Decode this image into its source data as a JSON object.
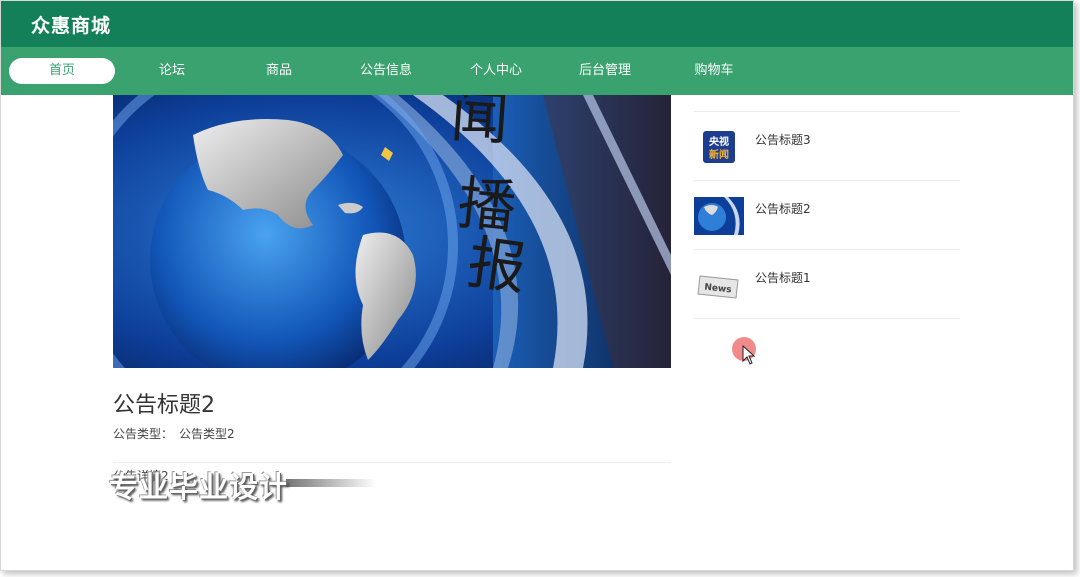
{
  "header": {
    "site_name": "众惠商城"
  },
  "nav": {
    "items": [
      {
        "label": "首页",
        "active": true
      },
      {
        "label": "论坛"
      },
      {
        "label": "商品"
      },
      {
        "label": "公告信息"
      },
      {
        "label": "个人中心"
      },
      {
        "label": "后台管理"
      },
      {
        "label": "购物车"
      }
    ]
  },
  "article": {
    "image_text": "闻播报",
    "title": "公告标题2",
    "type_label": "公告类型：",
    "type_value": "公告类型2",
    "body": "公告详情2"
  },
  "sidebar": {
    "items": [
      {
        "title": "公告标题3",
        "thumb_text_top": "央视",
        "thumb_text_bottom": "新闻"
      },
      {
        "title": "公告标题2"
      },
      {
        "title": "公告标题1",
        "thumb_text": "News"
      }
    ]
  },
  "overlay": {
    "watermark": "专业毕业设计"
  },
  "colors": {
    "topbar": "#13805a",
    "navbar": "#3aa26f",
    "active_tab_text": "#3aa26f"
  }
}
